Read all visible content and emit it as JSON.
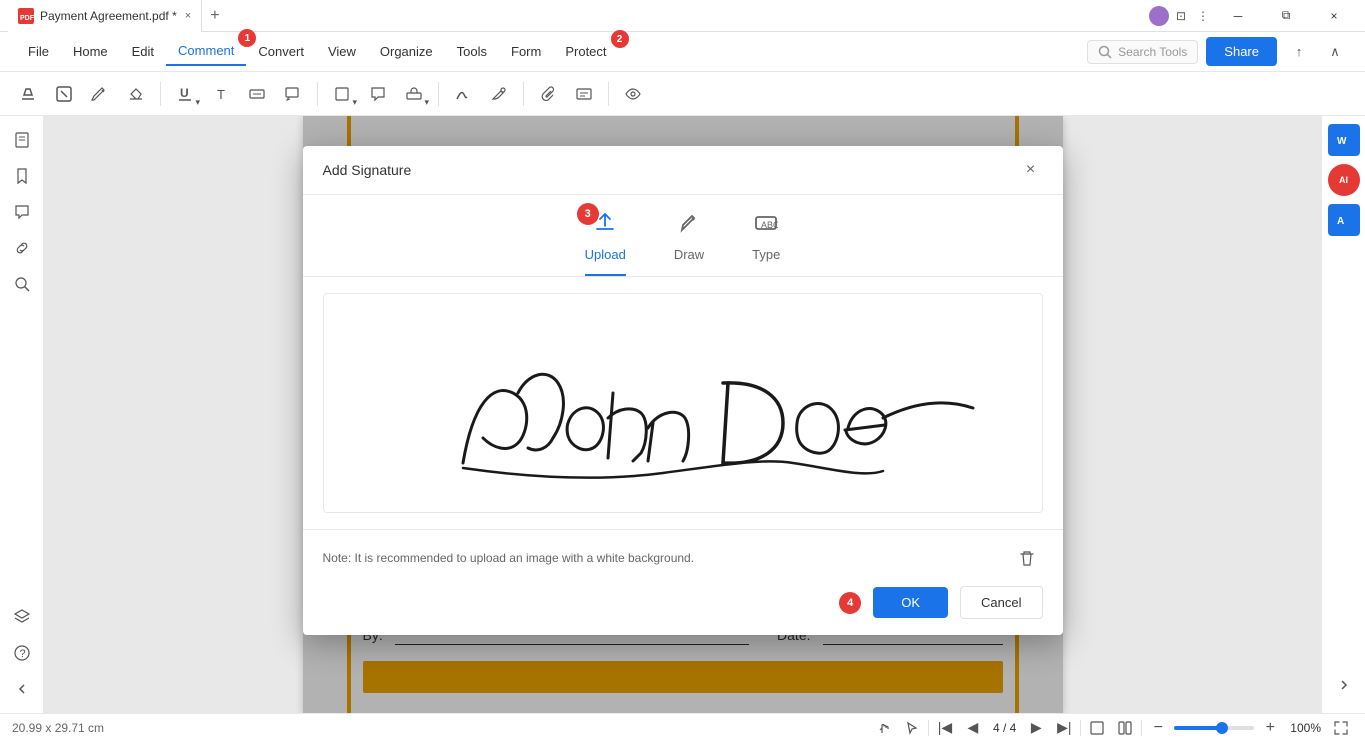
{
  "titlebar": {
    "title": "Payment Agreement.pdf *",
    "close_tab_label": "×",
    "new_tab_label": "+",
    "minimize": "─",
    "restore": "⧉",
    "close": "×"
  },
  "menubar": {
    "items": [
      {
        "id": "file",
        "label": "File"
      },
      {
        "id": "home",
        "label": "Home"
      },
      {
        "id": "edit",
        "label": "Edit"
      },
      {
        "id": "comment",
        "label": "Comment",
        "active": true,
        "badge": "1"
      },
      {
        "id": "convert",
        "label": "Convert"
      },
      {
        "id": "view",
        "label": "View"
      },
      {
        "id": "organize",
        "label": "Organize"
      },
      {
        "id": "tools",
        "label": "Tools"
      },
      {
        "id": "form",
        "label": "Form"
      },
      {
        "id": "protect",
        "label": "Protect",
        "badge": "2"
      }
    ],
    "search_placeholder": "Search Tools",
    "share_label": "Share"
  },
  "dialog": {
    "title": "Add Signature",
    "tabs": [
      {
        "id": "upload",
        "label": "Upload",
        "active": true,
        "badge": "3"
      },
      {
        "id": "draw",
        "label": "Draw",
        "active": false
      },
      {
        "id": "type",
        "label": "Type",
        "active": false
      }
    ],
    "note": "Note: It is recommended to upload an image with a white background.",
    "ok_label": "OK",
    "cancel_label": "Cancel",
    "badge_4": "4"
  },
  "bottom_bar": {
    "dimensions": "20.99 x 29.71 cm",
    "page_info": "4 / 4",
    "zoom_level": "100%"
  },
  "pdf_content": {
    "by_label": "By:",
    "date_label": "Date:"
  },
  "sidebar": {
    "items": [
      "☰",
      "🔖",
      "💬",
      "🔗",
      "🔍",
      "⊕"
    ]
  }
}
